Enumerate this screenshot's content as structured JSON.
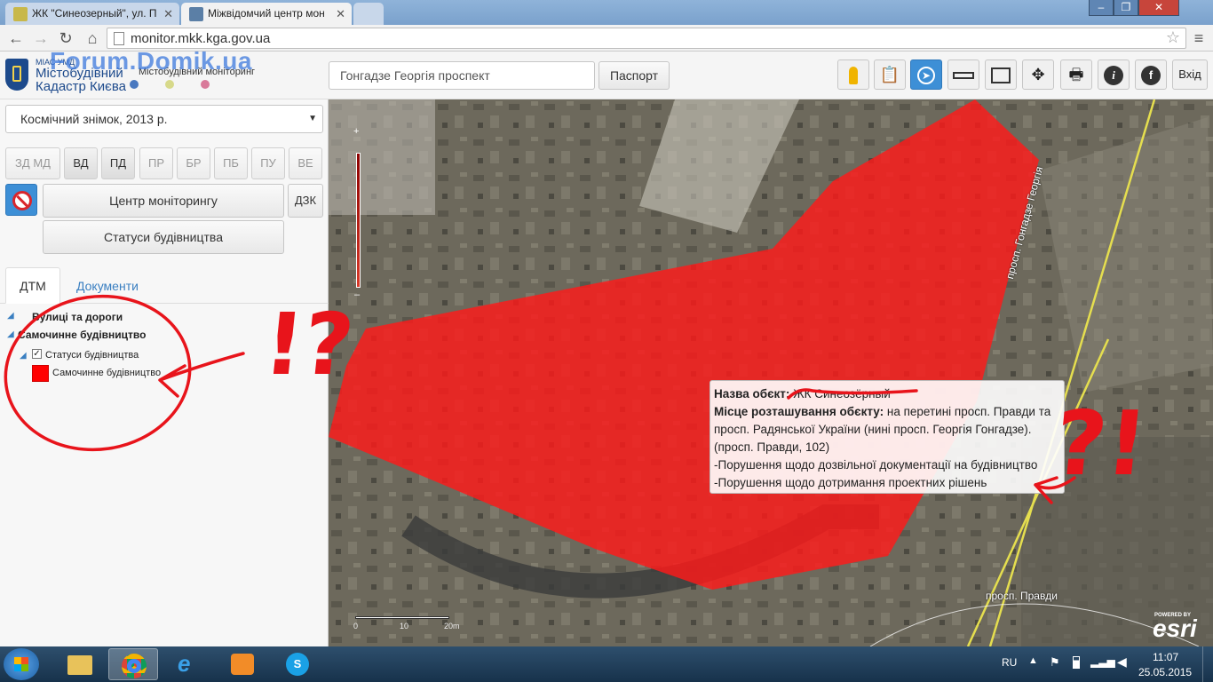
{
  "browser": {
    "tabs": [
      {
        "title": "ЖК \"Синеозерный\", ул. П"
      },
      {
        "title": "Міжвідомчий центр мон"
      }
    ],
    "url": "monitor.mkk.kga.gov.ua"
  },
  "watermark": "Forum.Domik.ua",
  "app": {
    "logo": {
      "small": "МІАС УМД",
      "line1": "Містобудівний",
      "line2": "Кадастр Києва",
      "subtitle": "Містобудівний моніторинг"
    },
    "search_value": "Гонгадзе Георгія проспект",
    "passport_button": "Паспорт",
    "exit_button": "Вхід"
  },
  "left_panel": {
    "basemap_select": "Космічний знімок, 2013 р.",
    "layer_buttons": [
      "ЗД МД",
      "ВД",
      "ПД",
      "ПР",
      "БР",
      "ПБ",
      "ПУ",
      "ВЕ"
    ],
    "monitoring_button": "Центр моніторингу",
    "dzk_button": "ДЗК",
    "statuses_button": "Статуси будівництва",
    "tabs": [
      "ДТМ",
      "Документи"
    ],
    "tree": {
      "streets": "Вулиці та дороги",
      "illegal": "Самочинне будівництво",
      "statuses": "Статуси будівництва",
      "legend_item": "Самочинне будівництво"
    }
  },
  "map": {
    "scale_labels": [
      "0",
      "10",
      "20m"
    ],
    "road_label_1": "просп. Гонгадзе Георгія",
    "road_label_2": "просп. Правди",
    "esri_powered": "POWERED BY",
    "esri": "esri",
    "popup": {
      "name_label": "Назва обєкт:",
      "name_value": "ЖК Синеозёрный",
      "location_label": "Місце розташування обєкту:",
      "location_value": "на перетині просп. Правди та просп. Радянської України (нині просп. Георгія Гонгадзе). (просп. Правди, 102)",
      "violation_1": "-Порушення щодо дозвільної документації на будівництво",
      "violation_2": "-Порушення щодо дотримання проектних рішень"
    },
    "annotation_1": "!?",
    "annotation_2": "?!"
  },
  "taskbar": {
    "lang": "RU",
    "time": "11:07",
    "date": "25.05.2015"
  },
  "colors": {
    "illegal_red": "#ff1a1a",
    "accent_blue": "#3d8fd6",
    "annotation_red": "#e8141b"
  },
  "icons": [
    "pegman-icon",
    "clipboard-icon",
    "compass-icon",
    "ruler-icon",
    "measure-area-icon",
    "extent-icon",
    "printer-icon",
    "info-icon",
    "facebook-icon"
  ]
}
